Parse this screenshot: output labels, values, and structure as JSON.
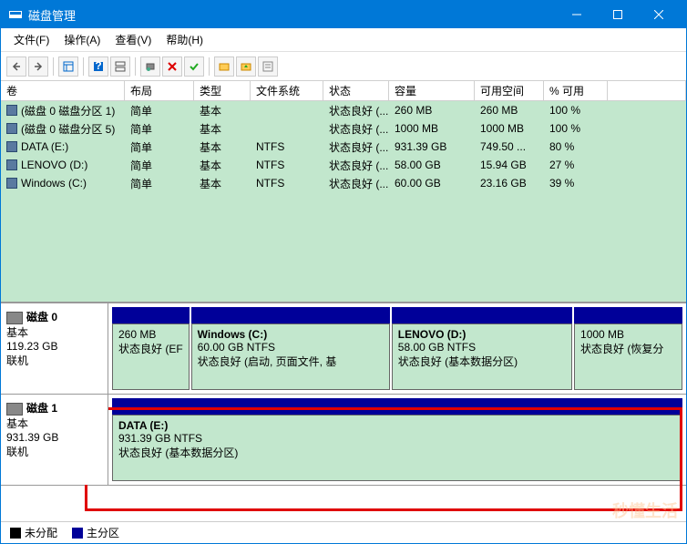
{
  "window": {
    "title": "磁盘管理"
  },
  "menu": {
    "file": "文件(F)",
    "action": "操作(A)",
    "view": "查看(V)",
    "help": "帮助(H)"
  },
  "columns": {
    "vol": "卷",
    "layout": "布局",
    "type": "类型",
    "fs": "文件系统",
    "status": "状态",
    "cap": "容量",
    "free": "可用空间",
    "pct": "% 可用"
  },
  "volumes": [
    {
      "name": "(磁盘 0 磁盘分区 1)",
      "layout": "简单",
      "type": "基本",
      "fs": "",
      "status": "状态良好 (...",
      "cap": "260 MB",
      "free": "260 MB",
      "pct": "100 %"
    },
    {
      "name": "(磁盘 0 磁盘分区 5)",
      "layout": "简单",
      "type": "基本",
      "fs": "",
      "status": "状态良好 (...",
      "cap": "1000 MB",
      "free": "1000 MB",
      "pct": "100 %"
    },
    {
      "name": "DATA (E:)",
      "layout": "简单",
      "type": "基本",
      "fs": "NTFS",
      "status": "状态良好 (...",
      "cap": "931.39 GB",
      "free": "749.50 ...",
      "pct": "80 %"
    },
    {
      "name": "LENOVO (D:)",
      "layout": "简单",
      "type": "基本",
      "fs": "NTFS",
      "status": "状态良好 (...",
      "cap": "58.00 GB",
      "free": "15.94 GB",
      "pct": "27 %"
    },
    {
      "name": "Windows (C:)",
      "layout": "简单",
      "type": "基本",
      "fs": "NTFS",
      "status": "状态良好 (...",
      "cap": "60.00 GB",
      "free": "23.16 GB",
      "pct": "39 %"
    }
  ],
  "disks": [
    {
      "name": "磁盘 0",
      "type": "基本",
      "size": "119.23 GB",
      "status": "联机",
      "parts": [
        {
          "title": "",
          "line2": "260 MB",
          "line3": "状态良好 (EF",
          "grow": 0.8
        },
        {
          "title": "Windows  (C:)",
          "line2": "60.00 GB NTFS",
          "line3": "状态良好 (启动, 页面文件, 基",
          "grow": 2.2
        },
        {
          "title": "LENOVO  (D:)",
          "line2": "58.00 GB NTFS",
          "line3": "状态良好 (基本数据分区)",
          "grow": 2.0
        },
        {
          "title": "",
          "line2": "1000 MB",
          "line3": "状态良好 (恢复分",
          "grow": 1.2
        }
      ]
    },
    {
      "name": "磁盘 1",
      "type": "基本",
      "size": "931.39 GB",
      "status": "联机",
      "parts": [
        {
          "title": "DATA  (E:)",
          "line2": "931.39 GB NTFS",
          "line3": "状态良好 (基本数据分区)",
          "grow": 1
        }
      ]
    }
  ],
  "legend": {
    "unalloc": "未分配",
    "primary": "主分区"
  }
}
